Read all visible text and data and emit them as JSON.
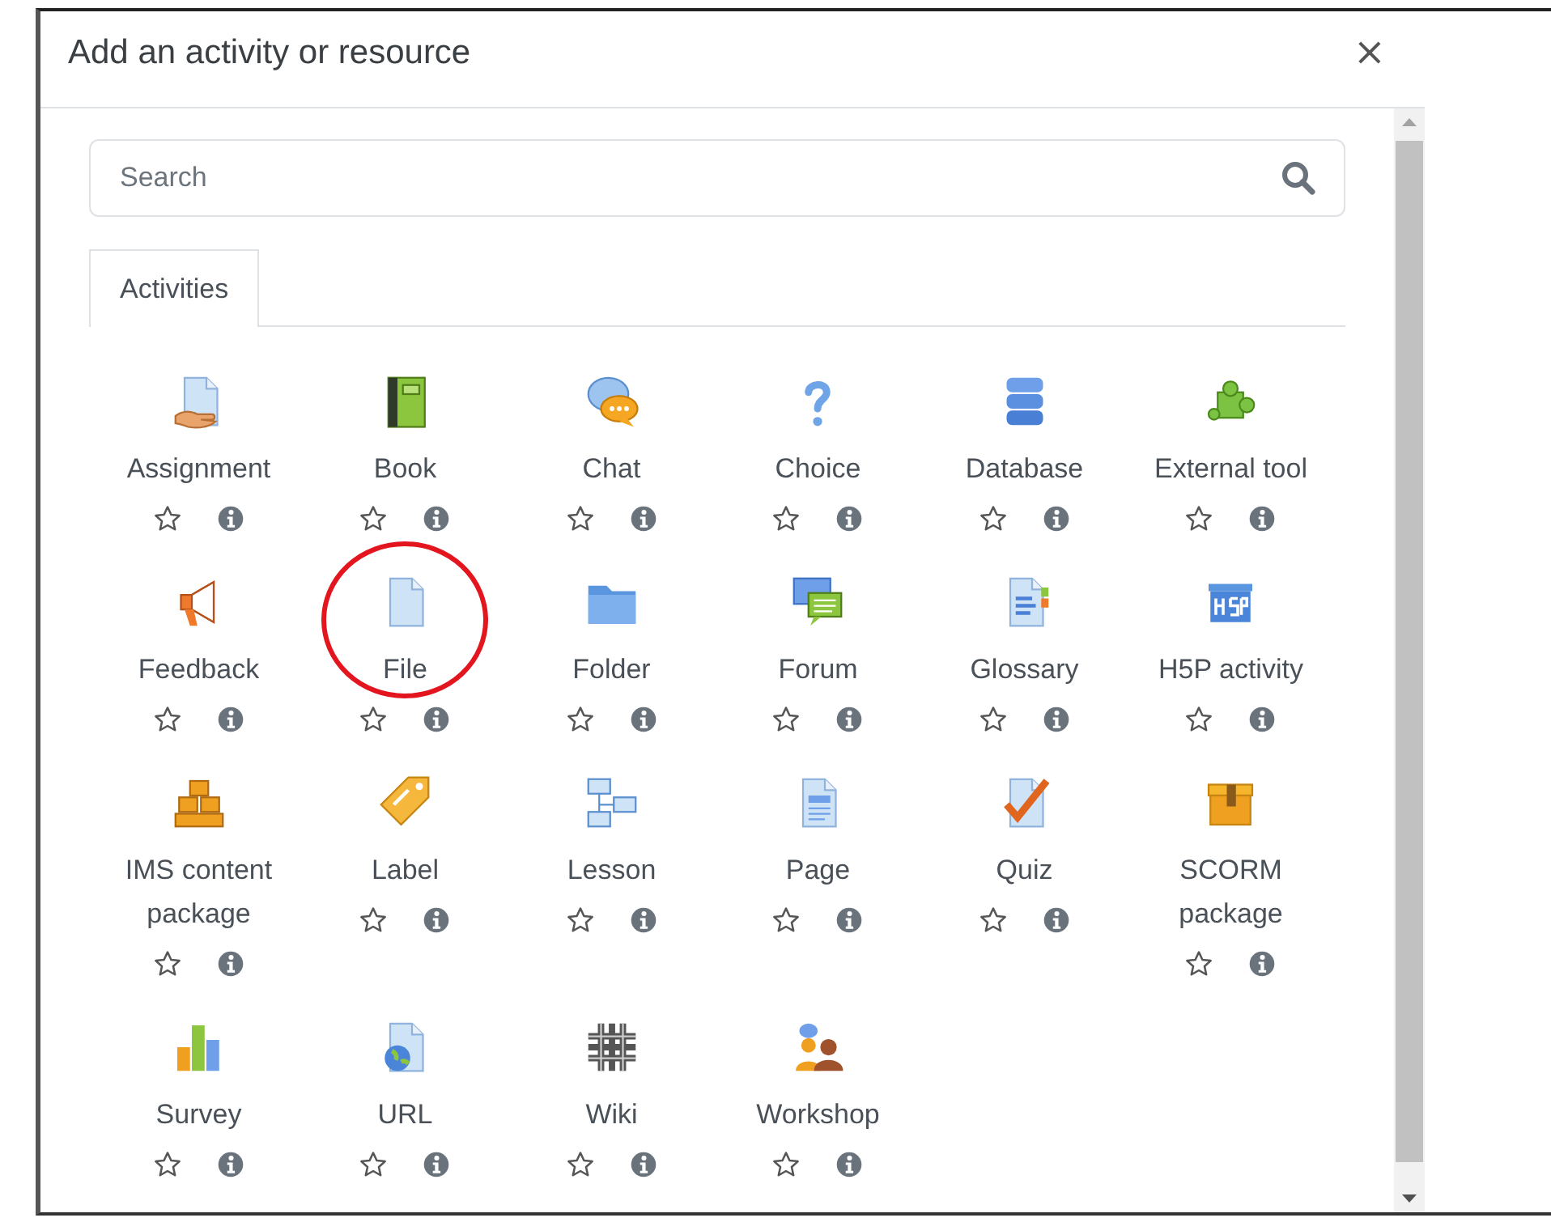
{
  "dialog": {
    "title": "Add an activity or resource",
    "close": "×"
  },
  "search": {
    "placeholder": "Search"
  },
  "tabs": [
    {
      "label": "Activities",
      "selected": true
    }
  ],
  "modules": [
    {
      "kind": "assignment",
      "name": "Assignment",
      "starred": false,
      "highlighted": false
    },
    {
      "kind": "book",
      "name": "Book",
      "starred": false,
      "highlighted": false
    },
    {
      "kind": "chat",
      "name": "Chat",
      "starred": false,
      "highlighted": false
    },
    {
      "kind": "choice",
      "name": "Choice",
      "starred": false,
      "highlighted": false
    },
    {
      "kind": "database",
      "name": "Database",
      "starred": false,
      "highlighted": false
    },
    {
      "kind": "lti",
      "name": "External tool",
      "starred": false,
      "highlighted": false
    },
    {
      "kind": "feedback",
      "name": "Feedback",
      "starred": false,
      "highlighted": false
    },
    {
      "kind": "file",
      "name": "File",
      "starred": false,
      "highlighted": true
    },
    {
      "kind": "folder",
      "name": "Folder",
      "starred": false,
      "highlighted": false
    },
    {
      "kind": "forum",
      "name": "Forum",
      "starred": false,
      "highlighted": false
    },
    {
      "kind": "glossary",
      "name": "Glossary",
      "starred": false,
      "highlighted": false
    },
    {
      "kind": "h5p",
      "name": "H5P activity",
      "starred": false,
      "highlighted": false
    },
    {
      "kind": "ims",
      "name": "IMS content package",
      "starred": false,
      "highlighted": false
    },
    {
      "kind": "label",
      "name": "Label",
      "starred": false,
      "highlighted": false
    },
    {
      "kind": "lesson",
      "name": "Lesson",
      "starred": false,
      "highlighted": false
    },
    {
      "kind": "page",
      "name": "Page",
      "starred": false,
      "highlighted": false
    },
    {
      "kind": "quiz",
      "name": "Quiz",
      "starred": false,
      "highlighted": false
    },
    {
      "kind": "scorm",
      "name": "SCORM package",
      "starred": false,
      "highlighted": false
    },
    {
      "kind": "survey",
      "name": "Survey",
      "starred": false,
      "highlighted": false
    },
    {
      "kind": "url",
      "name": "URL",
      "starred": false,
      "highlighted": false
    },
    {
      "kind": "wiki",
      "name": "Wiki",
      "starred": false,
      "highlighted": false
    },
    {
      "kind": "workshop",
      "name": "Workshop",
      "starred": false,
      "highlighted": false
    }
  ]
}
